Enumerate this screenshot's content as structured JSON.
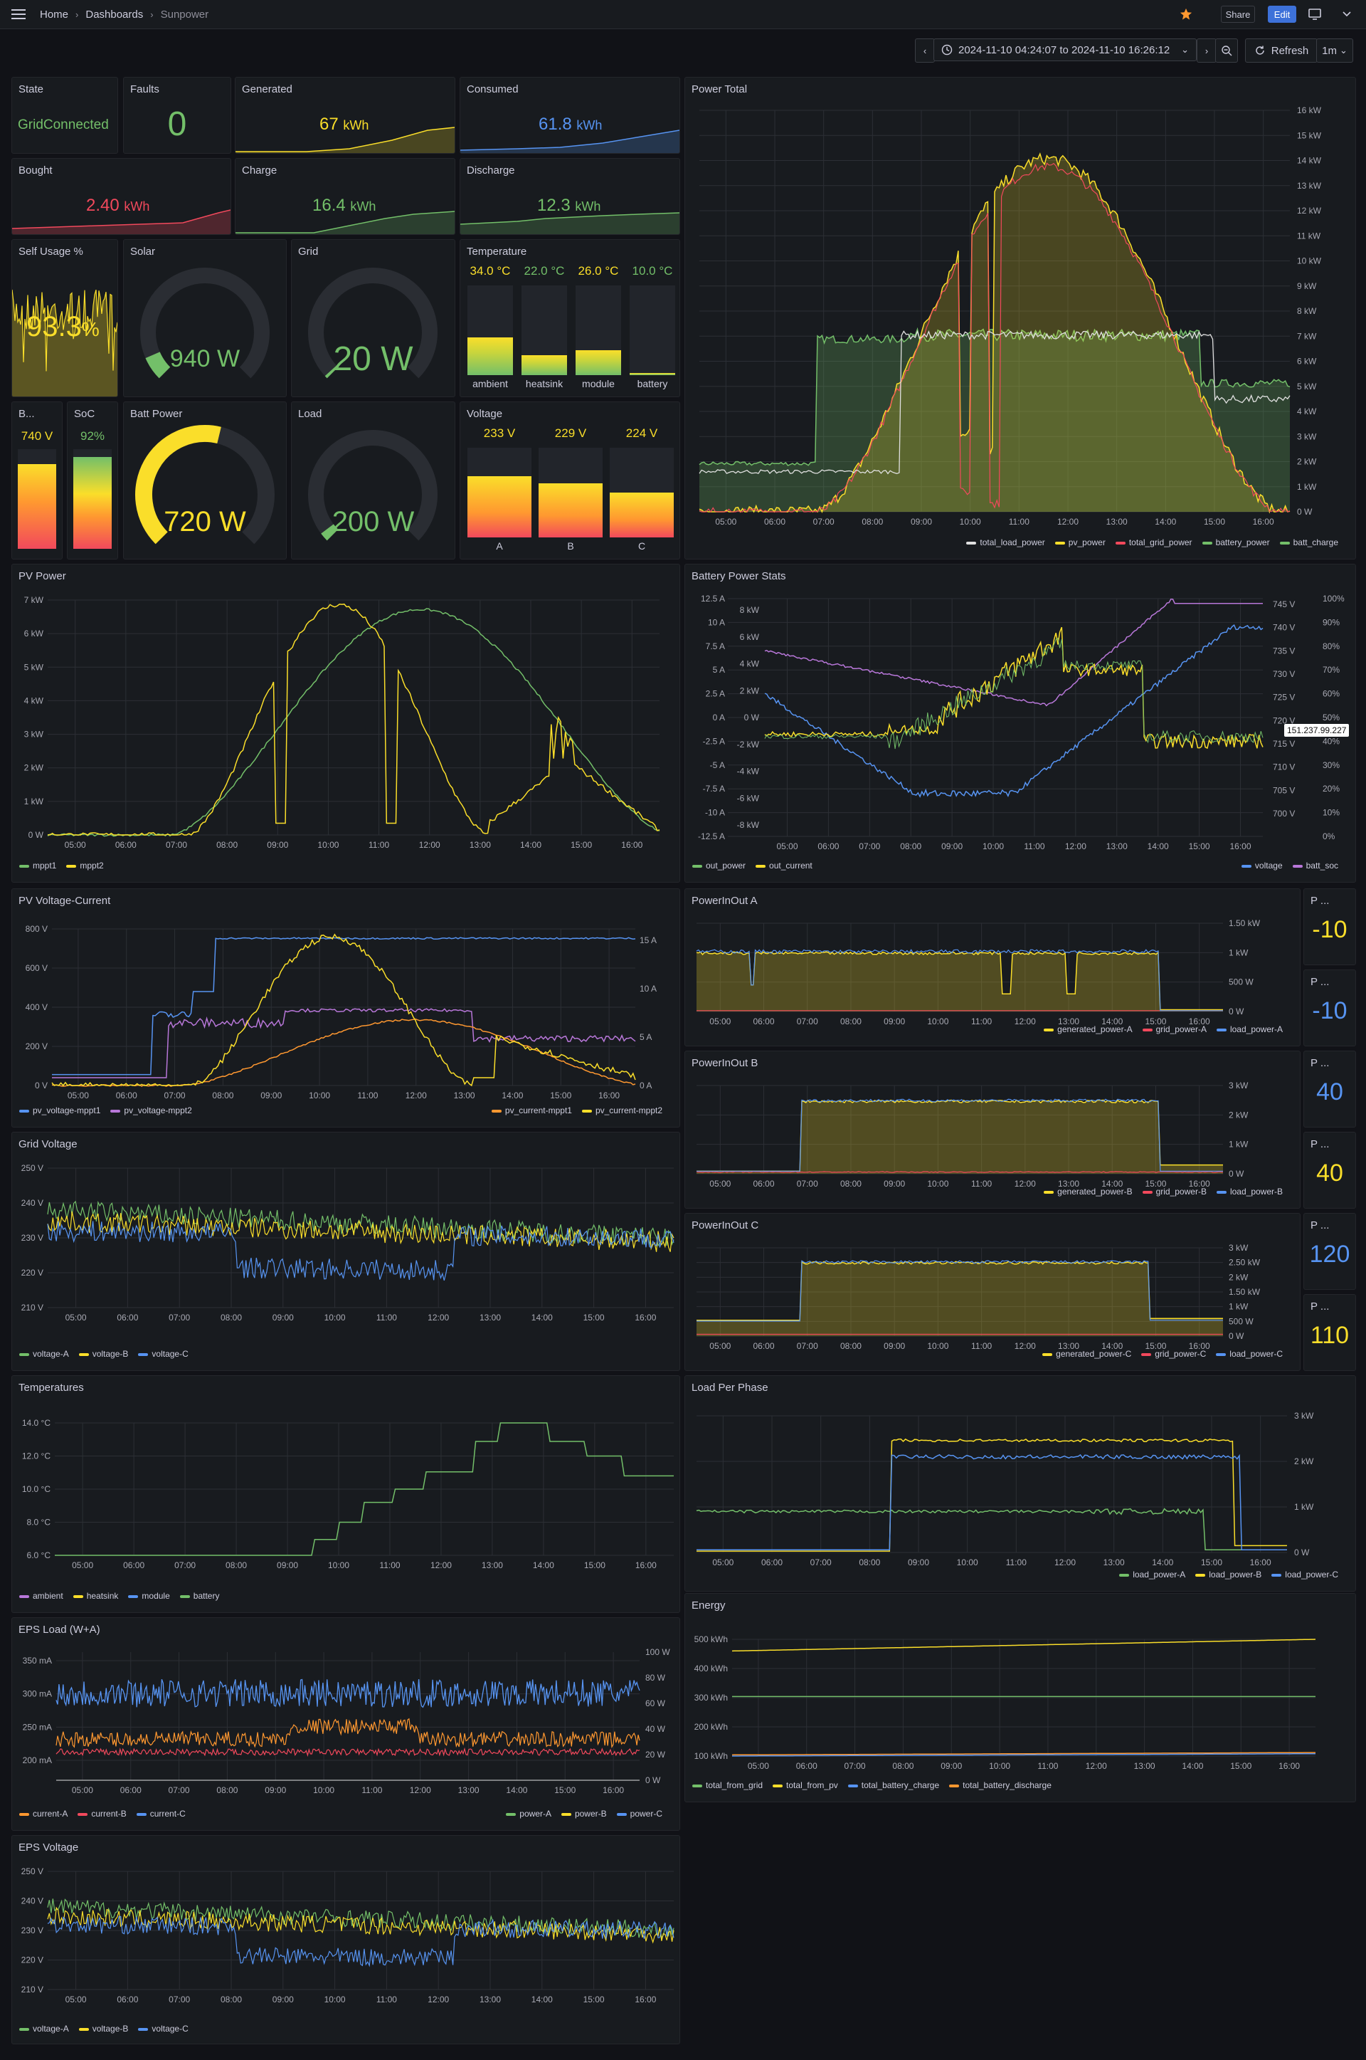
{
  "breadcrumb": {
    "home": "Home",
    "dashboards": "Dashboards",
    "current": "Sunpower"
  },
  "toolbar": {
    "share": "Share",
    "edit": "Edit",
    "time_range": "2024-11-10 04:24:07 to 2024-11-10 16:26:12",
    "refresh": "Refresh",
    "interval": "1m"
  },
  "colors": {
    "green": "#73bf69",
    "yellow": "#fade2a",
    "blue": "#5794f2",
    "red": "#f2495c",
    "orange": "#ff9830",
    "purple": "#b877d9",
    "white": "#e0e0e0"
  },
  "stats": {
    "state": {
      "title": "State",
      "value": "GridConnected"
    },
    "faults": {
      "title": "Faults",
      "value": "0"
    },
    "generated": {
      "title": "Generated",
      "value": "67",
      "unit": "kWh"
    },
    "consumed": {
      "title": "Consumed",
      "value": "61.8",
      "unit": "kWh"
    },
    "bought": {
      "title": "Bought",
      "value": "2.40",
      "unit": "kWh"
    },
    "charge": {
      "title": "Charge",
      "value": "16.4",
      "unit": "kWh"
    },
    "discharge": {
      "title": "Discharge",
      "value": "12.3",
      "unit": "kWh"
    },
    "self_usage": {
      "title": "Self Usage %",
      "value": "93.3",
      "unit": "%"
    },
    "solar": {
      "title": "Solar",
      "value": "940 W",
      "fraction": 0.08
    },
    "grid": {
      "title": "Grid",
      "value": "20 W",
      "fraction": 0.01
    },
    "batt_power": {
      "title": "Batt Power",
      "value": "720 W",
      "fraction": 0.55
    },
    "load": {
      "title": "Load",
      "value": "200 W",
      "fraction": 0.03
    },
    "batt_v": {
      "title": "B...",
      "value": "740 V",
      "fraction": 0.85
    },
    "soc": {
      "title": "SoC",
      "value": "92%",
      "fraction": 0.92
    }
  },
  "temperature": {
    "title": "Temperature",
    "items": [
      {
        "label": "ambient",
        "value": "34.0 °C",
        "fraction": 0.42
      },
      {
        "label": "heatsink",
        "value": "22.0 °C",
        "fraction": 0.22
      },
      {
        "label": "module",
        "value": "26.0 °C",
        "fraction": 0.28
      },
      {
        "label": "battery",
        "value": "10.0 °C",
        "fraction": 0.02
      }
    ]
  },
  "voltage": {
    "title": "Voltage",
    "items": [
      {
        "label": "A",
        "value": "233 V",
        "fraction": 0.68
      },
      {
        "label": "B",
        "value": "229 V",
        "fraction": 0.6
      },
      {
        "label": "C",
        "value": "224 V",
        "fraction": 0.5
      }
    ]
  },
  "phase_stats": [
    {
      "title": "P ...",
      "value": "-10",
      "color": "#fade2a"
    },
    {
      "title": "P ...",
      "value": "-10",
      "color": "#5794f2"
    },
    {
      "title": "P ...",
      "value": "40",
      "color": "#5794f2"
    },
    {
      "title": "P ...",
      "value": "40",
      "color": "#fade2a"
    },
    {
      "title": "P ...",
      "value": "120",
      "color": "#5794f2"
    },
    {
      "title": "P ...",
      "value": "110",
      "color": "#fade2a"
    }
  ],
  "time_ticks": [
    "05:00",
    "06:00",
    "07:00",
    "08:00",
    "09:00",
    "10:00",
    "11:00",
    "12:00",
    "13:00",
    "14:00",
    "15:00",
    "16:00"
  ],
  "panels": {
    "power_total": {
      "title": "Power Total",
      "y_ticks": [
        "16 kW",
        "15 kW",
        "14 kW",
        "13 kW",
        "12 kW",
        "11 kW",
        "10 kW",
        "9 kW",
        "8 kW",
        "7 kW",
        "6 kW",
        "5 kW",
        "4 kW",
        "3 kW",
        "2 kW",
        "1 kW",
        "0 W"
      ],
      "legend": [
        "total_load_power",
        "pv_power",
        "total_grid_power",
        "battery_power",
        "batt_charge"
      ]
    },
    "pv_power": {
      "title": "PV Power",
      "y_ticks": [
        "7 kW",
        "6 kW",
        "5 kW",
        "4 kW",
        "3 kW",
        "2 kW",
        "1 kW",
        "0 W"
      ],
      "legend": [
        "mppt1",
        "mppt2"
      ]
    },
    "battery_stats": {
      "title": "Battery Power Stats",
      "y_left1": [
        "12.5 A",
        "10 A",
        "7.5 A",
        "5 A",
        "2.5 A",
        "0 A",
        "-2.5 A",
        "-5 A",
        "-7.5 A",
        "-10 A",
        "-12.5 A"
      ],
      "y_left2": [
        "8 kW",
        "6 kW",
        "4 kW",
        "2 kW",
        "0 W",
        "-2 kW",
        "-4 kW",
        "-6 kW",
        "-8 kW"
      ],
      "y_right1": [
        "745 V",
        "740 V",
        "735 V",
        "730 V",
        "725 V",
        "720 V",
        "715 V",
        "710 V",
        "705 V",
        "700 V"
      ],
      "y_right2": [
        "100%",
        "90%",
        "80%",
        "70%",
        "60%",
        "50%",
        "40%",
        "30%",
        "20%",
        "10%",
        "0%"
      ],
      "tooltip": "151.237.99.227",
      "legend_left": [
        "out_power",
        "out_current"
      ],
      "legend_right": [
        "voltage",
        "batt_soc"
      ]
    },
    "pv_vc": {
      "title": "PV Voltage-Current",
      "y_left": [
        "800 V",
        "600 V",
        "400 V",
        "200 V",
        "0 V"
      ],
      "y_right": [
        "15 A",
        "10 A",
        "5 A",
        "0 A"
      ],
      "legend_left": [
        "pv_voltage-mppt1",
        "pv_voltage-mppt2"
      ],
      "legend_right": [
        "pv_current-mppt1",
        "pv_current-mppt2"
      ]
    },
    "pio_a": {
      "title": "PowerInOut A",
      "y_ticks": [
        "1.50 kW",
        "1 kW",
        "500 W",
        "0 W"
      ],
      "legend": [
        "generated_power-A",
        "grid_power-A",
        "load_power-A"
      ]
    },
    "pio_b": {
      "title": "PowerInOut B",
      "y_ticks": [
        "3 kW",
        "2 kW",
        "1 kW",
        "0 W"
      ],
      "legend": [
        "generated_power-B",
        "grid_power-B",
        "load_power-B"
      ]
    },
    "pio_c": {
      "title": "PowerInOut C",
      "y_ticks": [
        "3 kW",
        "2.50 kW",
        "2 kW",
        "1.50 kW",
        "1 kW",
        "500 W",
        "0 W"
      ],
      "legend": [
        "generated_power-C",
        "grid_power-C",
        "load_power-C"
      ]
    },
    "grid_voltage": {
      "title": "Grid Voltage",
      "y_ticks": [
        "250 V",
        "240 V",
        "230 V",
        "220 V",
        "210 V"
      ],
      "legend": [
        "voltage-A",
        "voltage-B",
        "voltage-C"
      ]
    },
    "temperatures": {
      "title": "Temperatures",
      "y_ticks": [
        "14.0 °C",
        "12.0 °C",
        "10.0 °C",
        "8.0 °C",
        "6.0 °C"
      ],
      "legend": [
        "ambient",
        "heatsink",
        "module",
        "battery"
      ]
    },
    "load_phase": {
      "title": "Load Per Phase",
      "y_ticks": [
        "3 kW",
        "2 kW",
        "1 kW",
        "0 W"
      ],
      "legend": [
        "load_power-A",
        "load_power-B",
        "load_power-C"
      ]
    },
    "energy": {
      "title": "Energy",
      "y_ticks": [
        "500 kWh",
        "400 kWh",
        "300 kWh",
        "200 kWh",
        "100 kWh"
      ],
      "legend": [
        "total_from_grid",
        "total_from_pv",
        "total_battery_charge",
        "total_battery_discharge"
      ]
    },
    "eps_load": {
      "title": "EPS Load (W+A)",
      "y_left": [
        "350 mA",
        "300 mA",
        "250 mA",
        "200 mA"
      ],
      "y_right": [
        "100 W",
        "80 W",
        "60 W",
        "40 W",
        "20 W",
        "0 W"
      ],
      "legend_left": [
        "current-A",
        "current-B",
        "current-C"
      ],
      "legend_right": [
        "power-A",
        "power-B",
        "power-C"
      ]
    },
    "eps_voltage": {
      "title": "EPS Voltage",
      "y_ticks": [
        "250 V",
        "240 V",
        "230 V",
        "220 V",
        "210 V"
      ],
      "legend": [
        "voltage-A",
        "voltage-B",
        "voltage-C"
      ]
    }
  }
}
